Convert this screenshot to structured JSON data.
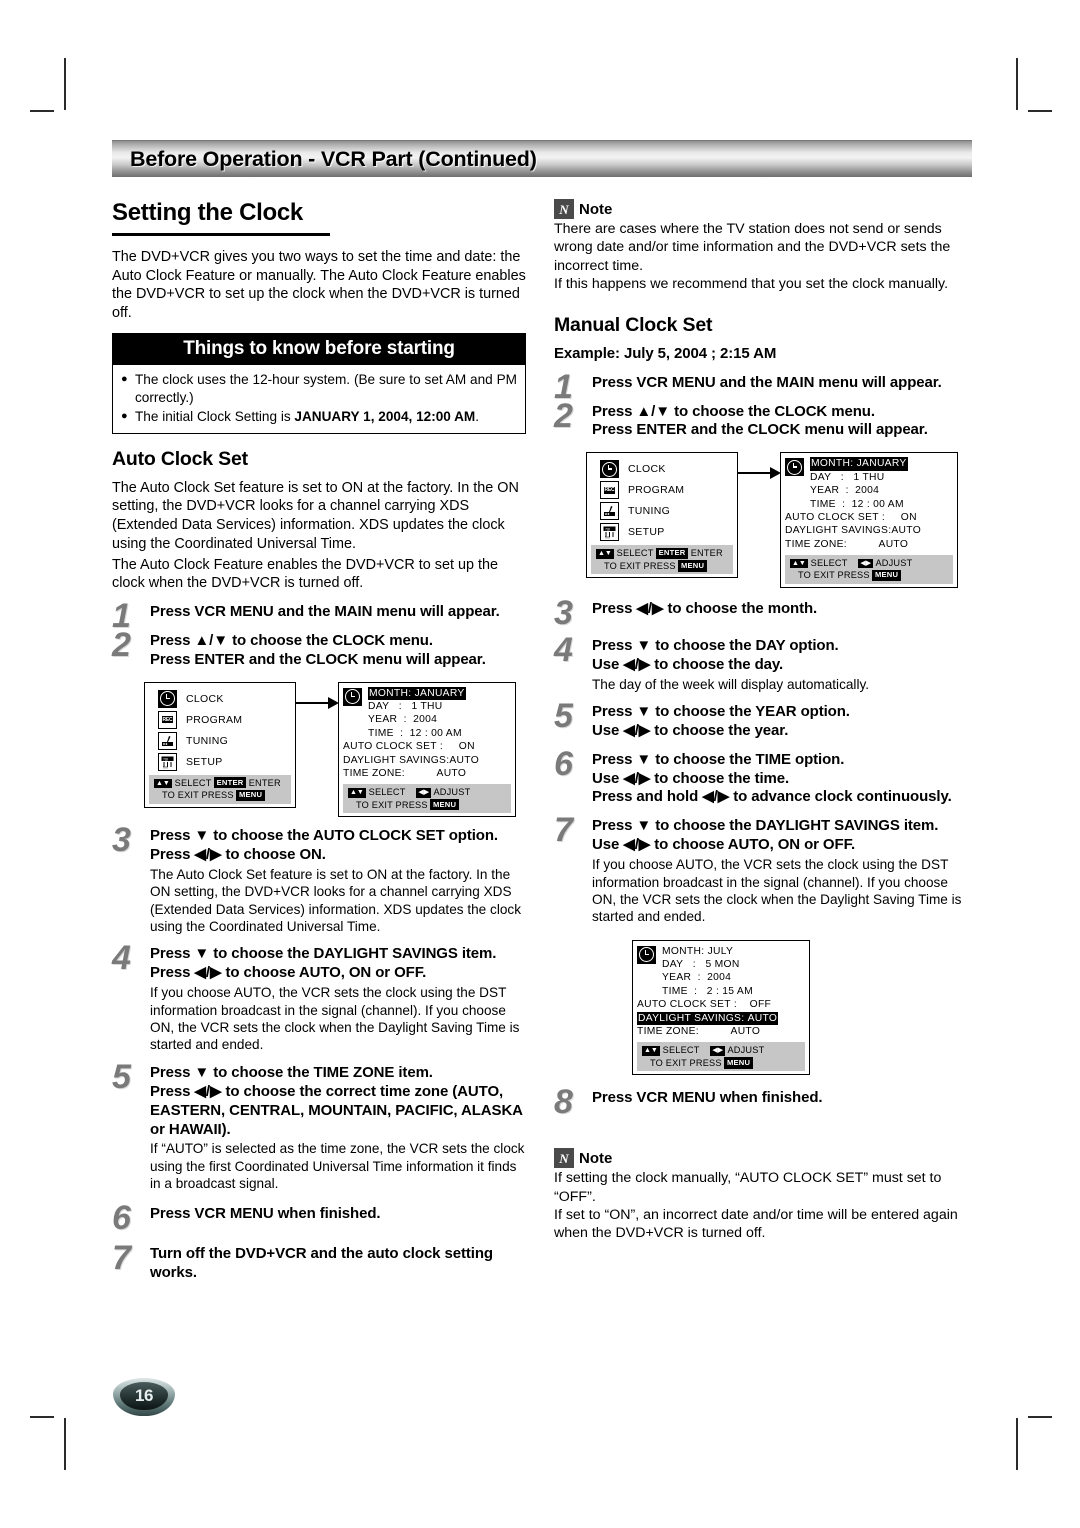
{
  "header": {
    "title": "Before Operation - VCR Part (Continued)"
  },
  "page_number": "16",
  "left": {
    "section_title": "Setting the Clock",
    "intro": "The DVD+VCR gives you two ways to set the time and date: the Auto Clock Feature or manually. The Auto Clock Feature enables the DVD+VCR to set up the clock when the DVD+VCR is turned off.",
    "tips": {
      "heading": "Things to know before starting",
      "items": [
        {
          "text_before": "The clock uses the 12-hour system. (Be sure to set AM and PM correctly.)",
          "bold": "",
          "text_after": ""
        },
        {
          "text_before": "The initial Clock Setting is ",
          "bold": "JANUARY 1, 2004, 12:00 AM",
          "text_after": "."
        }
      ]
    },
    "auto_clock_title": "Auto Clock Set",
    "auto_clock_p1": "The Auto Clock Set feature is set to ON at the factory. In the ON setting, the DVD+VCR looks for a channel carrying XDS (Extended Data Services) information. XDS updates the clock using the Coordinated Universal Time.",
    "auto_clock_p2": "The Auto Clock Feature enables the DVD+VCR to set up the clock when the DVD+VCR is turned off.",
    "steps": [
      {
        "num": "1",
        "main": "Press VCR MENU and the MAIN menu will appear.",
        "main2": "",
        "sub": ""
      },
      {
        "num": "2",
        "main": "Press ▲/▼ to choose the CLOCK menu.",
        "main2": "Press ENTER and the CLOCK menu will appear.",
        "sub": ""
      },
      {
        "num": "3",
        "main": "Press ▼ to choose the AUTO CLOCK SET option.",
        "main2": "Press ◀/▶ to choose ON.",
        "sub": "The Auto Clock Set feature is set to ON at the factory. In the ON setting, the DVD+VCR looks for a channel carrying XDS (Extended Data Services) information. XDS updates the clock using the Coordinated Universal Time."
      },
      {
        "num": "4",
        "main": "Press ▼ to choose the DAYLIGHT SAVINGS item.",
        "main2": "Press ◀/▶ to choose AUTO, ON or OFF.",
        "sub": "If you choose AUTO, the VCR sets the clock using the DST information broadcast in the signal (channel). If you choose ON, the VCR sets the clock when the Daylight Saving Time is started and ended."
      },
      {
        "num": "5",
        "main": "Press ▼ to choose the TIME ZONE item.",
        "main2": "Press ◀/▶ to choose the correct time zone (AUTO, EASTERN, CENTRAL, MOUNTAIN, PACIFIC, ALASKA or HAWAII).",
        "sub": "If “AUTO” is selected as the time zone, the VCR sets the clock using the first Coordinated Universal Time information it finds in a broadcast signal."
      },
      {
        "num": "6",
        "main": "Press VCR MENU when finished.",
        "main2": "",
        "sub": ""
      },
      {
        "num": "7",
        "main": "Turn off the DVD+VCR and the auto clock setting works.",
        "main2": "",
        "sub": ""
      }
    ]
  },
  "right": {
    "note_top": {
      "badge": "N",
      "label": "Note",
      "body": "There are cases where the TV station does not send or sends wrong date and/or time information and the DVD+VCR sets the incorrect time.\nIf this happens we recommend that you set the clock manually."
    },
    "manual_title": "Manual Clock Set",
    "example": "Example: July 5, 2004 ;  2:15 AM",
    "steps": [
      {
        "num": "1",
        "main": "Press VCR MENU and the MAIN menu will appear.",
        "main2": "",
        "sub": ""
      },
      {
        "num": "2",
        "main": "Press ▲/▼ to choose the CLOCK menu.",
        "main2": "Press ENTER and the CLOCK menu will appear.",
        "sub": ""
      },
      {
        "num": "3",
        "main": "Press ◀/▶ to choose the month.",
        "main2": "",
        "sub": ""
      },
      {
        "num": "4",
        "main": "Press ▼ to choose the DAY option.",
        "main2": "Use ◀/▶ to choose the day.",
        "sub": "The day of the week will display automatically."
      },
      {
        "num": "5",
        "main": "Press ▼ to choose the YEAR option.",
        "main2": "Use ◀/▶ to choose the year.",
        "sub": ""
      },
      {
        "num": "6",
        "main": "Press ▼ to choose the TIME option.",
        "main2": "Use ◀/▶ to choose the time.",
        "main3": "Press and hold ◀/▶ to advance clock continuously.",
        "sub": ""
      },
      {
        "num": "7",
        "main": "Press ▼ to choose the DAYLIGHT SAVINGS item.",
        "main2": "Use ◀/▶ to choose AUTO, ON or OFF.",
        "sub": "If you choose AUTO, the VCR sets the clock using the DST information broadcast in the signal (channel). If you choose ON, the VCR sets the clock when the Daylight Saving Time is started and ended."
      },
      {
        "num": "8",
        "main": "Press VCR MENU when finished.",
        "main2": "",
        "sub": ""
      }
    ],
    "note_bottom": {
      "badge": "N",
      "label": "Note",
      "body": "If setting the clock manually, “AUTO CLOCK SET” must set to “OFF”.\nIf set to “ON”, an incorrect date and/or time will be entered again when the DVD+VCR is turned off."
    }
  },
  "osd": {
    "main_menu": {
      "items": [
        {
          "label": "CLOCK",
          "icon": "clock-icon",
          "selected": true
        },
        {
          "label": "PROGRAM",
          "icon": "rec-icon",
          "selected": false
        },
        {
          "label": "TUNING",
          "icon": "tuner-icon",
          "selected": false
        },
        {
          "label": "SETUP",
          "icon": "setup-icon",
          "selected": false
        }
      ],
      "footer_line1_a": "SELECT",
      "footer_line1_key": "ENTER",
      "footer_line1_b": "ENTER",
      "footer_line2": "TO  EXIT  PRESS",
      "footer_line2_key": "MENU"
    },
    "clock_menu_default": {
      "month_label": "MONTH:",
      "month_value": "JANUARY",
      "day_label": "DAY",
      "day_value": "1   THU",
      "year_label": "YEAR",
      "year_value": "2004",
      "time_label": "TIME",
      "time_value": "12 : 00   AM",
      "auto_clock_label": "AUTO CLOCK SET :",
      "auto_clock_value": "ON",
      "dst_label": "DAYLIGHT SAVINGS:",
      "dst_value": "AUTO",
      "tz_label": "TIME ZONE:",
      "tz_value": "AUTO",
      "highlight": "month",
      "footer_line1_a": "SELECT",
      "footer_line1_b": "ADJUST",
      "footer_line2": "TO  EXIT  PRESS",
      "footer_line2_key": "MENU"
    },
    "clock_menu_july": {
      "month_label": "MONTH:",
      "month_value": "JULY",
      "day_label": "DAY",
      "day_value": "5   MON",
      "year_label": "YEAR",
      "year_value": "2004",
      "time_label": "TIME",
      "time_value": "2 : 15   AM",
      "auto_clock_label": "AUTO CLOCK SET :",
      "auto_clock_value": "OFF",
      "dst_label": "DAYLIGHT SAVINGS:",
      "dst_value": "AUTO",
      "tz_label": "TIME ZONE:",
      "tz_value": "AUTO",
      "highlight": "dst",
      "footer_line1_a": "SELECT",
      "footer_line1_b": "ADJUST",
      "footer_line2": "TO  EXIT  PRESS",
      "footer_line2_key": "MENU"
    }
  }
}
